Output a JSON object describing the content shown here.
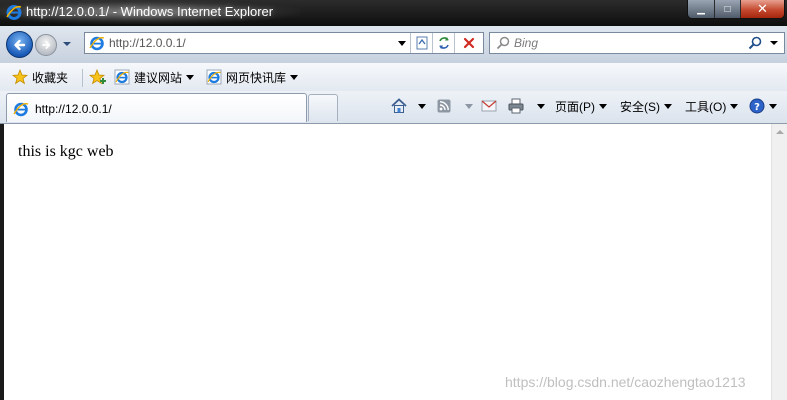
{
  "window": {
    "title": "http://12.0.0.1/ - Windows Internet Explorer",
    "controls": {
      "minimize": "▁",
      "maximize": "□",
      "close": "✕"
    }
  },
  "nav": {
    "address": "http://12.0.0.1/",
    "search_placeholder": "Bing"
  },
  "favorites_bar": {
    "favorites_label": "收藏夹",
    "items": [
      {
        "label": "建议网站"
      },
      {
        "label": "网页快讯库"
      }
    ]
  },
  "tab": {
    "title": "http://12.0.0.1/"
  },
  "command_bar": {
    "page_label": "页面(P)",
    "safety_label": "安全(S)",
    "tools_label": "工具(O)"
  },
  "page": {
    "body_text": "this is kgc web",
    "watermark": "https://blog.csdn.net/caozhengtao1213"
  },
  "colors": {
    "titlebar": "#0e0e0e",
    "ie_blue": "#1a5bb8",
    "close_red": "#c44a2f"
  },
  "icons": [
    "ie-icon",
    "back-arrow-icon",
    "forward-arrow-icon",
    "compatibility-icon",
    "refresh-icon",
    "stop-icon",
    "search-icon",
    "star-icon",
    "add-favorites-icon",
    "home-icon",
    "rss-icon",
    "mail-icon",
    "print-icon",
    "help-icon"
  ]
}
